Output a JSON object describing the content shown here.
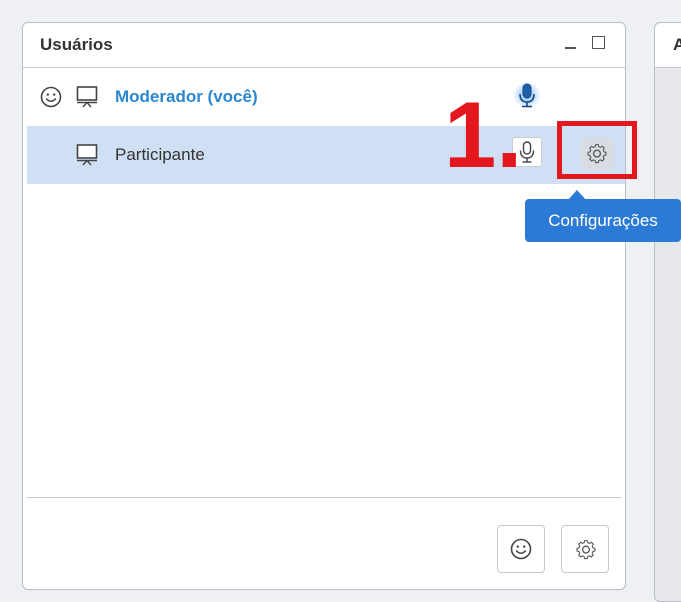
{
  "users_panel": {
    "title": "Usuários",
    "moderator": {
      "name": "Moderador (você)",
      "icons": [
        "smiley-icon",
        "presenter-icon",
        "microphone-icon"
      ]
    },
    "participant": {
      "name": "Participante",
      "icons": [
        "presenter-icon",
        "microphone-icon",
        "gear-icon"
      ]
    },
    "footer": {
      "icons": [
        "smiley-icon",
        "gear-icon"
      ]
    }
  },
  "right_panel": {
    "title": "A"
  },
  "annotation": {
    "step_label": "1.",
    "tooltip_text": "Configurações"
  },
  "colors": {
    "accent_blue": "#2a87d0",
    "selected_row": "#cfe0f4",
    "tooltip_bg": "#2b7bd6",
    "annotation_red": "#e4161e"
  }
}
